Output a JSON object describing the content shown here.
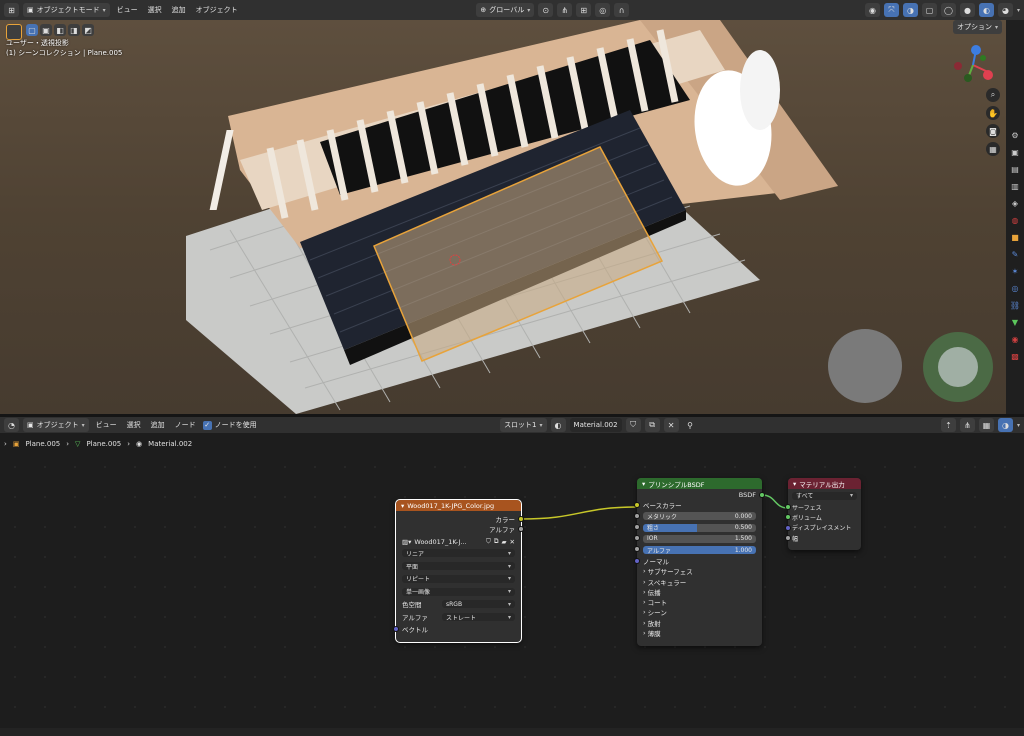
{
  "viewport_header": {
    "mode": "オブジェクトモード",
    "menus": [
      "ビュー",
      "選択",
      "追加",
      "オブジェクト"
    ],
    "transform_orientation": "グローバル",
    "options_label": "オプション"
  },
  "viewport": {
    "view_name": "ユーザー・透視投影",
    "collection_info": "(1) シーンコレクション | Plane.005"
  },
  "node_header": {
    "type": "オブジェクト",
    "menus": [
      "ビュー",
      "選択",
      "追加",
      "ノード"
    ],
    "use_nodes_label": "ノードを使用",
    "use_nodes_checked": true,
    "slot": "スロット1",
    "material": "Material.002"
  },
  "breadcrumb": [
    "Plane.005",
    "Plane.005",
    "Material.002"
  ],
  "image_node": {
    "title": "Wood017_1K-JPG_Color.jpg",
    "outputs": [
      "カラー",
      "アルファ"
    ],
    "image_name": "Wood017_1K-J...",
    "interpolation": "リニア",
    "projection": "平面",
    "extension": "リピート",
    "source": "単一画像",
    "color_space_label": "色空間",
    "color_space": "sRGB",
    "alpha_label": "アルファ",
    "alpha_mode": "ストレート",
    "vector_label": "ベクトル"
  },
  "bsdf_node": {
    "title": "プリンシプルBSDF",
    "output": "BSDF",
    "base_color": "ベースカラー",
    "fields": [
      {
        "label": "メタリック",
        "value": "0.000"
      },
      {
        "label": "粗さ",
        "value": "0.500"
      },
      {
        "label": "IOR",
        "value": "1.500"
      },
      {
        "label": "アルファ",
        "value": "1.000"
      }
    ],
    "normal": "ノーマル",
    "panels": [
      "サブサーフェス",
      "スペキュラー",
      "伝播",
      "コート",
      "シーン",
      "放射",
      "薄膜"
    ]
  },
  "output_node": {
    "title": "マテリアル出力",
    "target": "すべて",
    "inputs": [
      "サーフェス",
      "ボリューム",
      "ディスプレイスメント",
      "幅"
    ]
  },
  "colors": {
    "image_node_header": "#a8541f",
    "bsdf_node_header": "#2d6a2d",
    "output_node_header": "#6b2232",
    "accent": "#4772b3",
    "selection": "#e8a33a"
  }
}
